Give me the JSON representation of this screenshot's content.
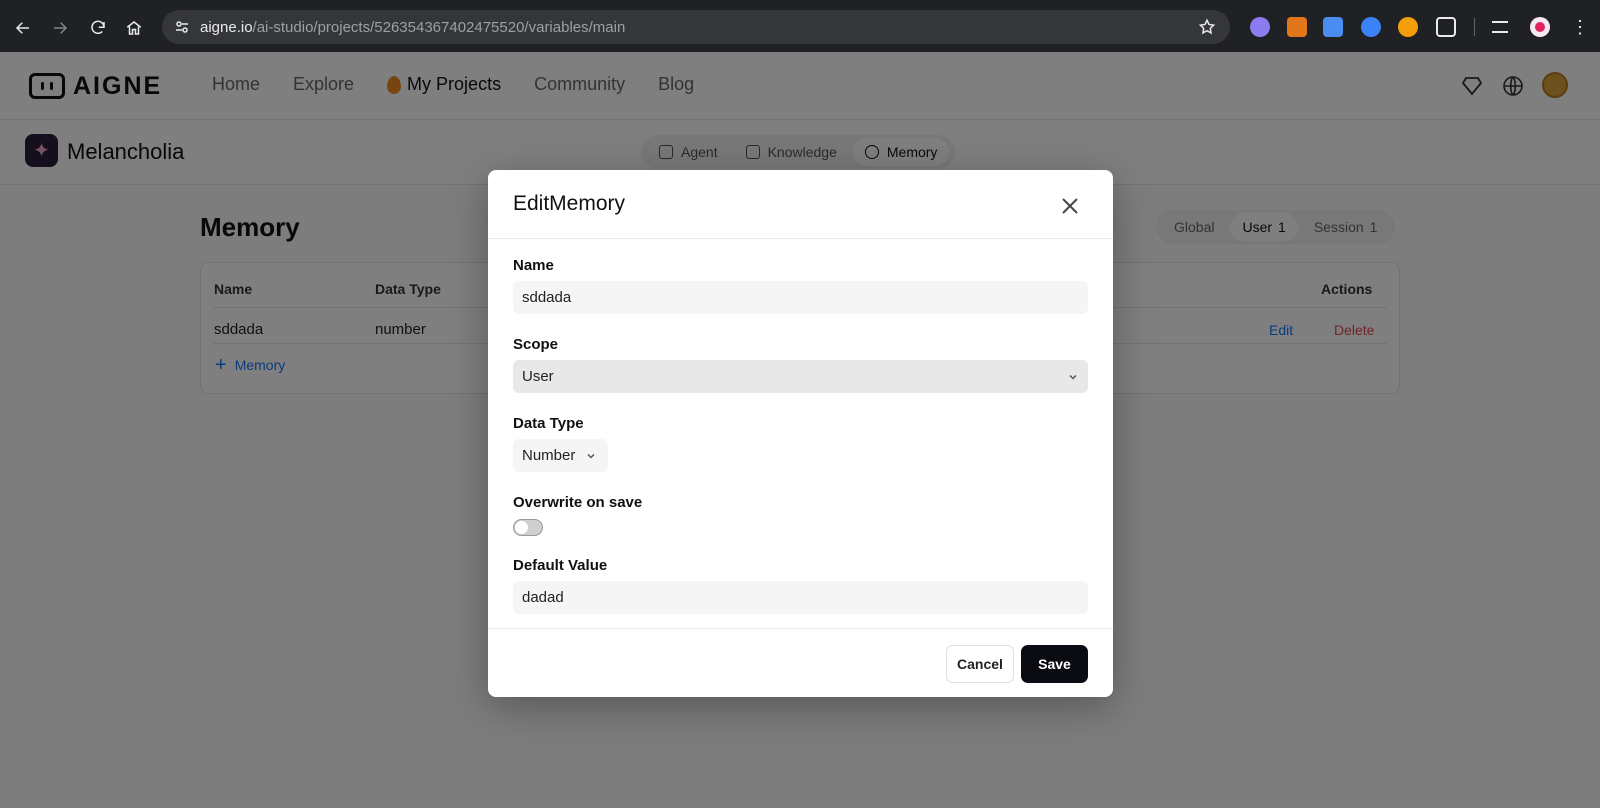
{
  "browser": {
    "url_host": "aigne.io",
    "url_path": "/ai-studio/projects/526354367402475520/variables/main",
    "extension_colors": [
      "#8c7cf0",
      "#e2761b",
      "#4a8cf0",
      "#3b82f6",
      "#f59e0b"
    ]
  },
  "appbar": {
    "brand": "AIGNE",
    "nav": [
      {
        "label": "Home"
      },
      {
        "label": "Explore"
      },
      {
        "label": "My Projects"
      },
      {
        "label": "Community"
      },
      {
        "label": "Blog"
      }
    ]
  },
  "project": {
    "name": "Melancholia",
    "tabs": [
      {
        "label": "Agent"
      },
      {
        "label": "Knowledge"
      },
      {
        "label": "Memory"
      }
    ]
  },
  "memory_page": {
    "title": "Memory",
    "scope_tabs": [
      {
        "label": "Global",
        "count": ""
      },
      {
        "label": "User",
        "count": "1"
      },
      {
        "label": "Session",
        "count": "1"
      }
    ],
    "columns": {
      "name": "Name",
      "data_type": "Data Type",
      "actions": "Actions"
    },
    "rows": [
      {
        "name": "sddada",
        "data_type": "number",
        "edit": "Edit",
        "delete": "Delete"
      }
    ],
    "add_label": "Memory"
  },
  "dialog": {
    "title": "EditMemory",
    "name_label": "Name",
    "name_value": "sddada",
    "scope_label": "Scope",
    "scope_value": "User",
    "data_type_label": "Data Type",
    "data_type_value": "Number",
    "overwrite_label": "Overwrite on save",
    "overwrite_on": false,
    "default_label": "Default Value",
    "default_value": "dadad",
    "cancel": "Cancel",
    "save": "Save"
  }
}
